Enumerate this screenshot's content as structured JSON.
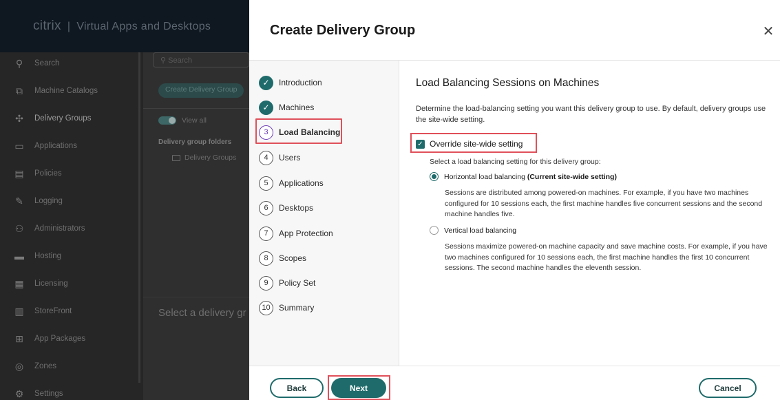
{
  "background": {
    "brand_logo": "citrix",
    "brand_name": "Virtual Apps and Desktops",
    "nav": [
      {
        "label": "Search",
        "icon": "search-icon"
      },
      {
        "label": "Machine Catalogs",
        "icon": "catalog-icon"
      },
      {
        "label": "Delivery Groups",
        "icon": "delivery-groups-icon"
      },
      {
        "label": "Applications",
        "icon": "applications-icon"
      },
      {
        "label": "Policies",
        "icon": "policies-icon"
      },
      {
        "label": "Logging",
        "icon": "logging-icon"
      },
      {
        "label": "Administrators",
        "icon": "administrators-icon"
      },
      {
        "label": "Hosting",
        "icon": "hosting-icon"
      },
      {
        "label": "Licensing",
        "icon": "licensing-icon"
      },
      {
        "label": "StoreFront",
        "icon": "storefront-icon"
      },
      {
        "label": "App Packages",
        "icon": "app-packages-icon"
      },
      {
        "label": "Zones",
        "icon": "zones-icon"
      },
      {
        "label": "Settings",
        "icon": "settings-icon"
      }
    ],
    "search_placeholder": "Search",
    "create_button": "Create Delivery Group",
    "view_all": "View all",
    "folders_title": "Delivery group folders",
    "folder_name": "Delivery Groups",
    "select_text": "Select a delivery gr"
  },
  "dialog": {
    "title": "Create Delivery Group",
    "steps": [
      {
        "label": "Introduction",
        "status": "done"
      },
      {
        "label": "Machines",
        "status": "done"
      },
      {
        "num": "3",
        "label": "Load Balancing",
        "status": "current"
      },
      {
        "num": "4",
        "label": "Users",
        "status": "todo"
      },
      {
        "num": "5",
        "label": "Applications",
        "status": "todo"
      },
      {
        "num": "6",
        "label": "Desktops",
        "status": "todo"
      },
      {
        "num": "7",
        "label": "App Protection",
        "status": "todo"
      },
      {
        "num": "8",
        "label": "Scopes",
        "status": "todo"
      },
      {
        "num": "9",
        "label": "Policy Set",
        "status": "todo"
      },
      {
        "num": "10",
        "label": "Summary",
        "status": "todo"
      }
    ],
    "heading": "Load Balancing Sessions on Machines",
    "description": "Determine the load-balancing setting you want this delivery group to use. By default, delivery groups use the site-wide setting.",
    "override_label": "Override site-wide setting",
    "override_checked": true,
    "select_label": "Select a load balancing setting for this delivery group:",
    "options": [
      {
        "label": "Horizontal load balancing",
        "suffix": "(Current site-wide setting)",
        "selected": true,
        "description": "Sessions are distributed among powered-on machines. For example, if you have two machines configured for 10 sessions each, the first machine handles five concurrent sessions and the second machine handles five."
      },
      {
        "label": "Vertical load balancing",
        "suffix": "",
        "selected": false,
        "description": "Sessions maximize powered-on machine capacity and save machine costs. For example, if you have two machines configured for 10 sessions each, the first machine handles the first 10 concurrent sessions. The second machine handles the eleventh session."
      }
    ],
    "back_label": "Back",
    "next_label": "Next",
    "cancel_label": "Cancel",
    "accent_color": "#1f6b6b",
    "highlight_color": "#e0505a"
  }
}
